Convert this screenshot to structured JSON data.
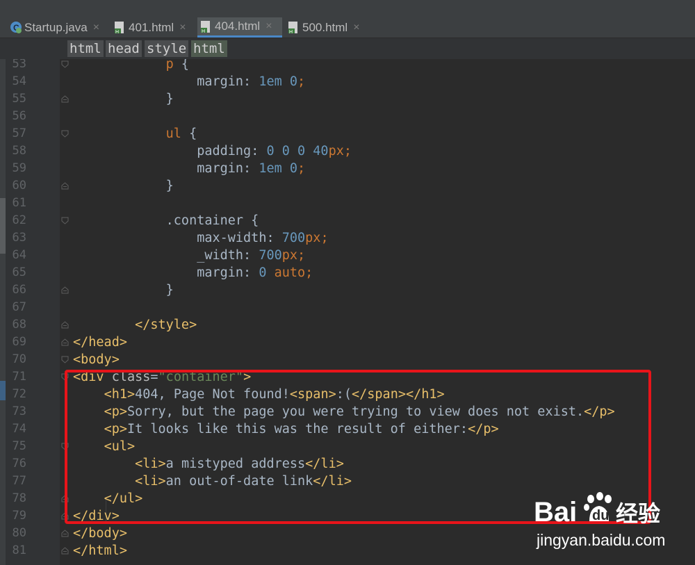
{
  "tabs": [
    {
      "label": "Startup.java",
      "icon": "java-class-icon",
      "active": false
    },
    {
      "label": "401.html",
      "icon": "html-file-icon",
      "active": false
    },
    {
      "label": "404.html",
      "icon": "html-file-icon",
      "active": true
    },
    {
      "label": "500.html",
      "icon": "html-file-icon",
      "active": false
    }
  ],
  "tab_close_glyph": "×",
  "breadcrumb": [
    "html",
    "head",
    "style",
    "html"
  ],
  "colors": {
    "tag": "#e8bf6a",
    "attr": "#bababa",
    "value": "#6a8759",
    "text": "#a9b7c6",
    "selector": "#cc7832",
    "property": "#a9b7c6",
    "number": "#6897bb",
    "keyword": "#cc7832",
    "highlight_box": "#e8141a",
    "background": "#2b2b2b"
  },
  "code": [
    {
      "n": "53",
      "tokens": [
        {
          "t": "            ",
          "c": "text"
        },
        {
          "t": "p",
          "c": "selector"
        },
        {
          "t": " {",
          "c": "text"
        }
      ]
    },
    {
      "n": "54",
      "tokens": [
        {
          "t": "                ",
          "c": "text"
        },
        {
          "t": "margin",
          "c": "property"
        },
        {
          "t": ": ",
          "c": "text"
        },
        {
          "t": "1em",
          "c": "number"
        },
        {
          "t": " ",
          "c": "text"
        },
        {
          "t": "0",
          "c": "number"
        },
        {
          "t": ";",
          "c": "keyword"
        }
      ]
    },
    {
      "n": "55",
      "tokens": [
        {
          "t": "            }",
          "c": "text"
        }
      ]
    },
    {
      "n": "56",
      "tokens": []
    },
    {
      "n": "57",
      "tokens": [
        {
          "t": "            ",
          "c": "text"
        },
        {
          "t": "ul",
          "c": "selector"
        },
        {
          "t": " {",
          "c": "text"
        }
      ]
    },
    {
      "n": "58",
      "tokens": [
        {
          "t": "                ",
          "c": "text"
        },
        {
          "t": "padding",
          "c": "property"
        },
        {
          "t": ": ",
          "c": "text"
        },
        {
          "t": "0 0 0 ",
          "c": "number"
        },
        {
          "t": "40",
          "c": "number"
        },
        {
          "t": "px",
          "c": "keyword"
        },
        {
          "t": ";",
          "c": "keyword"
        }
      ]
    },
    {
      "n": "59",
      "tokens": [
        {
          "t": "                ",
          "c": "text"
        },
        {
          "t": "margin",
          "c": "property"
        },
        {
          "t": ": ",
          "c": "text"
        },
        {
          "t": "1em",
          "c": "number"
        },
        {
          "t": " ",
          "c": "text"
        },
        {
          "t": "0",
          "c": "number"
        },
        {
          "t": ";",
          "c": "keyword"
        }
      ]
    },
    {
      "n": "60",
      "tokens": [
        {
          "t": "            }",
          "c": "text"
        }
      ]
    },
    {
      "n": "61",
      "tokens": []
    },
    {
      "n": "62",
      "tokens": [
        {
          "t": "            ",
          "c": "text"
        },
        {
          "t": ".container",
          "c": "text"
        },
        {
          "t": " {",
          "c": "text"
        }
      ]
    },
    {
      "n": "63",
      "tokens": [
        {
          "t": "                ",
          "c": "text"
        },
        {
          "t": "max-width",
          "c": "property"
        },
        {
          "t": ": ",
          "c": "text"
        },
        {
          "t": "700",
          "c": "number"
        },
        {
          "t": "px",
          "c": "keyword"
        },
        {
          "t": ";",
          "c": "keyword"
        }
      ]
    },
    {
      "n": "64",
      "tokens": [
        {
          "t": "                ",
          "c": "text"
        },
        {
          "t": "_width",
          "c": "property"
        },
        {
          "t": ": ",
          "c": "text"
        },
        {
          "t": "700",
          "c": "number"
        },
        {
          "t": "px",
          "c": "keyword"
        },
        {
          "t": ";",
          "c": "keyword"
        }
      ]
    },
    {
      "n": "65",
      "tokens": [
        {
          "t": "                ",
          "c": "text"
        },
        {
          "t": "margin",
          "c": "property"
        },
        {
          "t": ": ",
          "c": "text"
        },
        {
          "t": "0",
          "c": "number"
        },
        {
          "t": " ",
          "c": "text"
        },
        {
          "t": "auto",
          "c": "keyword"
        },
        {
          "t": ";",
          "c": "keyword"
        }
      ]
    },
    {
      "n": "66",
      "tokens": [
        {
          "t": "            }",
          "c": "text"
        }
      ]
    },
    {
      "n": "67",
      "tokens": []
    },
    {
      "n": "68",
      "tokens": [
        {
          "t": "        ",
          "c": "text"
        },
        {
          "t": "</style>",
          "c": "tag"
        }
      ]
    },
    {
      "n": "69",
      "tokens": [
        {
          "t": "</head>",
          "c": "tag"
        }
      ]
    },
    {
      "n": "70",
      "tokens": [
        {
          "t": "<body>",
          "c": "tag"
        }
      ]
    },
    {
      "n": "71",
      "tokens": [
        {
          "t": "<div ",
          "c": "tag"
        },
        {
          "t": "class",
          "c": "attr"
        },
        {
          "t": "=",
          "c": "text"
        },
        {
          "t": "\"container\"",
          "c": "value"
        },
        {
          "t": ">",
          "c": "tag"
        }
      ]
    },
    {
      "n": "72",
      "tokens": [
        {
          "t": "    ",
          "c": "text"
        },
        {
          "t": "<h1>",
          "c": "tag"
        },
        {
          "t": "404, Page Not found!",
          "c": "text"
        },
        {
          "t": "<span>",
          "c": "tag"
        },
        {
          "t": ":(",
          "c": "text"
        },
        {
          "t": "</span>",
          "c": "tag"
        },
        {
          "t": "</h1>",
          "c": "tag"
        }
      ]
    },
    {
      "n": "73",
      "tokens": [
        {
          "t": "    ",
          "c": "text"
        },
        {
          "t": "<p>",
          "c": "tag"
        },
        {
          "t": "Sorry, but the page you were trying to view does not exist.",
          "c": "text"
        },
        {
          "t": "</p>",
          "c": "tag"
        }
      ]
    },
    {
      "n": "74",
      "tokens": [
        {
          "t": "    ",
          "c": "text"
        },
        {
          "t": "<p>",
          "c": "tag"
        },
        {
          "t": "It looks like this was the result of either:",
          "c": "text"
        },
        {
          "t": "</p>",
          "c": "tag"
        }
      ]
    },
    {
      "n": "75",
      "tokens": [
        {
          "t": "    ",
          "c": "text"
        },
        {
          "t": "<ul>",
          "c": "tag"
        }
      ]
    },
    {
      "n": "76",
      "tokens": [
        {
          "t": "        ",
          "c": "text"
        },
        {
          "t": "<li>",
          "c": "tag"
        },
        {
          "t": "a mistyped address",
          "c": "text"
        },
        {
          "t": "</li>",
          "c": "tag"
        }
      ]
    },
    {
      "n": "77",
      "tokens": [
        {
          "t": "        ",
          "c": "text"
        },
        {
          "t": "<li>",
          "c": "tag"
        },
        {
          "t": "an out-of-date link",
          "c": "text"
        },
        {
          "t": "</li>",
          "c": "tag"
        }
      ]
    },
    {
      "n": "78",
      "tokens": [
        {
          "t": "    ",
          "c": "text"
        },
        {
          "t": "</ul>",
          "c": "tag"
        }
      ]
    },
    {
      "n": "79",
      "tokens": [
        {
          "t": "</div>",
          "c": "tag"
        }
      ]
    },
    {
      "n": "80",
      "tokens": [
        {
          "t": "</body>",
          "c": "tag"
        }
      ]
    },
    {
      "n": "81",
      "tokens": [
        {
          "t": "</html>",
          "c": "tag"
        }
      ]
    }
  ],
  "watermark": {
    "logo": "Bai du 经验",
    "url": "jingyan.baidu.com"
  }
}
